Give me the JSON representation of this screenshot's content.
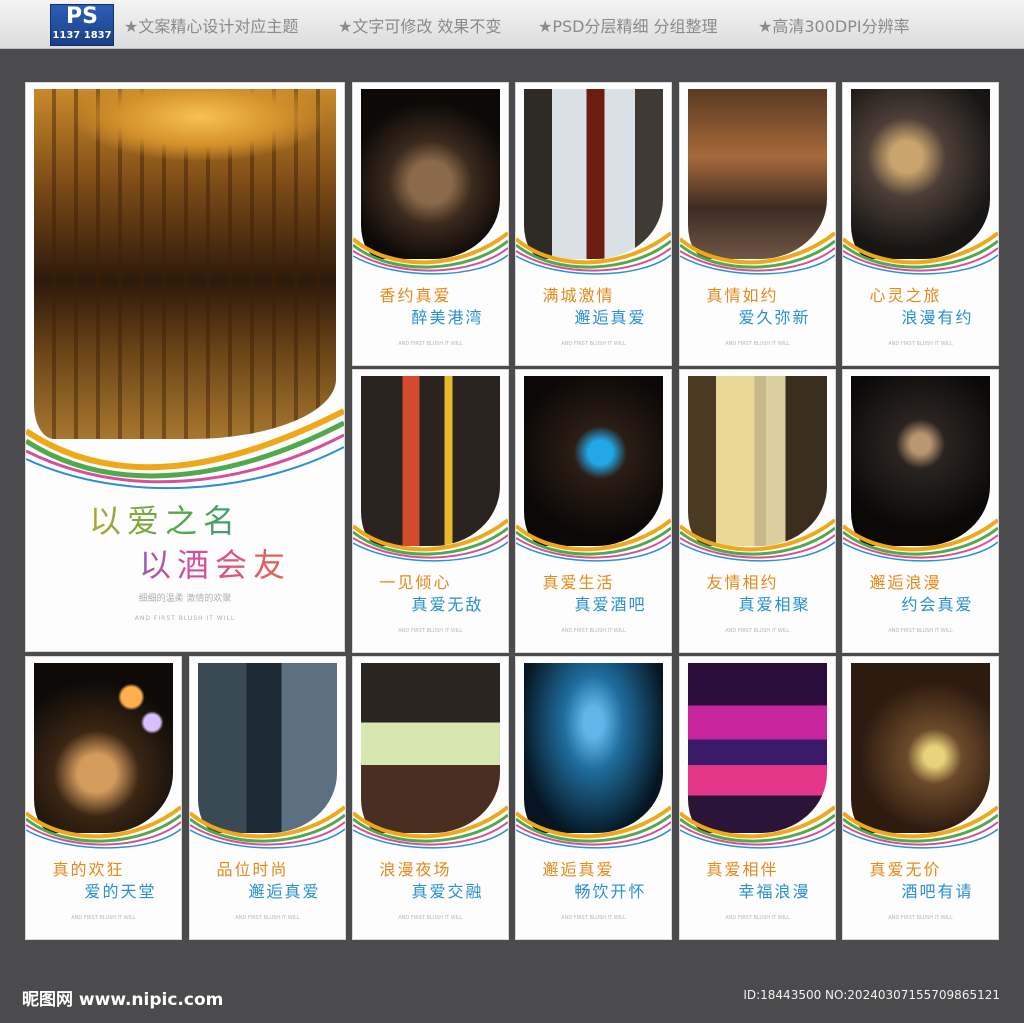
{
  "header": {
    "logo_text": "PS",
    "logo_id": "1137 1837",
    "features": [
      "★文案精心设计对应主题",
      "★文字可修改 效果不变",
      "★PSD分层精细 分组整理",
      "★高清300DPI分辨率"
    ],
    "background": "#e6e6e6"
  },
  "main_panel": {
    "title_line1": "以爱之名",
    "title_line2": "以酒会友",
    "subtitle": "细细的温柔 激情的欢聚",
    "english": "AND FIRST BLUSH IT WILL"
  },
  "panels": [
    {
      "line1": "香约真爱",
      "line2": "醉美港湾",
      "photo": "whiskey-glass-dark"
    },
    {
      "line1": "满城激情",
      "line2": "邂逅真爱",
      "photo": "wine-bottle-window"
    },
    {
      "line1": "真情如约",
      "line2": "爱久弥新",
      "photo": "bar-kitchen"
    },
    {
      "line1": "心灵之旅",
      "line2": "浪漫有约",
      "photo": "bartender-pouring"
    },
    {
      "line1": "一见倾心",
      "line2": "真爱无敌",
      "photo": "pub-crowd"
    },
    {
      "line1": "真爱生活",
      "line2": "真爱酒吧",
      "photo": "blue-cocktail"
    },
    {
      "line1": "友情相约",
      "line2": "真爱相聚",
      "photo": "bottle-glass"
    },
    {
      "line1": "邂逅浪漫",
      "line2": "约会真爱",
      "photo": "cocktail-dark"
    },
    {
      "line1": "真的欢狂",
      "line2": "爱的天堂",
      "photo": "cocktail-bokeh"
    },
    {
      "line1": "品位时尚",
      "line2": "邂逅真爱",
      "photo": "bartender-mixing"
    },
    {
      "line1": "浪漫夜场",
      "line2": "真爱交融",
      "photo": "lime-drinks"
    },
    {
      "line1": "邂逅真爱",
      "line2": "畅饮开怀",
      "photo": "concert-crowd"
    },
    {
      "line1": "真爱相伴",
      "line2": "幸福浪漫",
      "photo": "neon-club"
    },
    {
      "line1": "真爱无价",
      "line2": "酒吧有请",
      "photo": "cocktail-wood"
    }
  ],
  "panel_fine_text": "AND FIRST BLUSH IT WILL",
  "footer": {
    "brand": "昵图网 www.nipic.com",
    "id_text": "ID:18443500 NO:20240307155709865121"
  },
  "colors": {
    "background": "#4b4b4d",
    "accent_orange": "#e48a1c",
    "accent_green": "#52a84c",
    "accent_blue": "#2c8fd0",
    "accent_pink": "#d64f9a"
  }
}
